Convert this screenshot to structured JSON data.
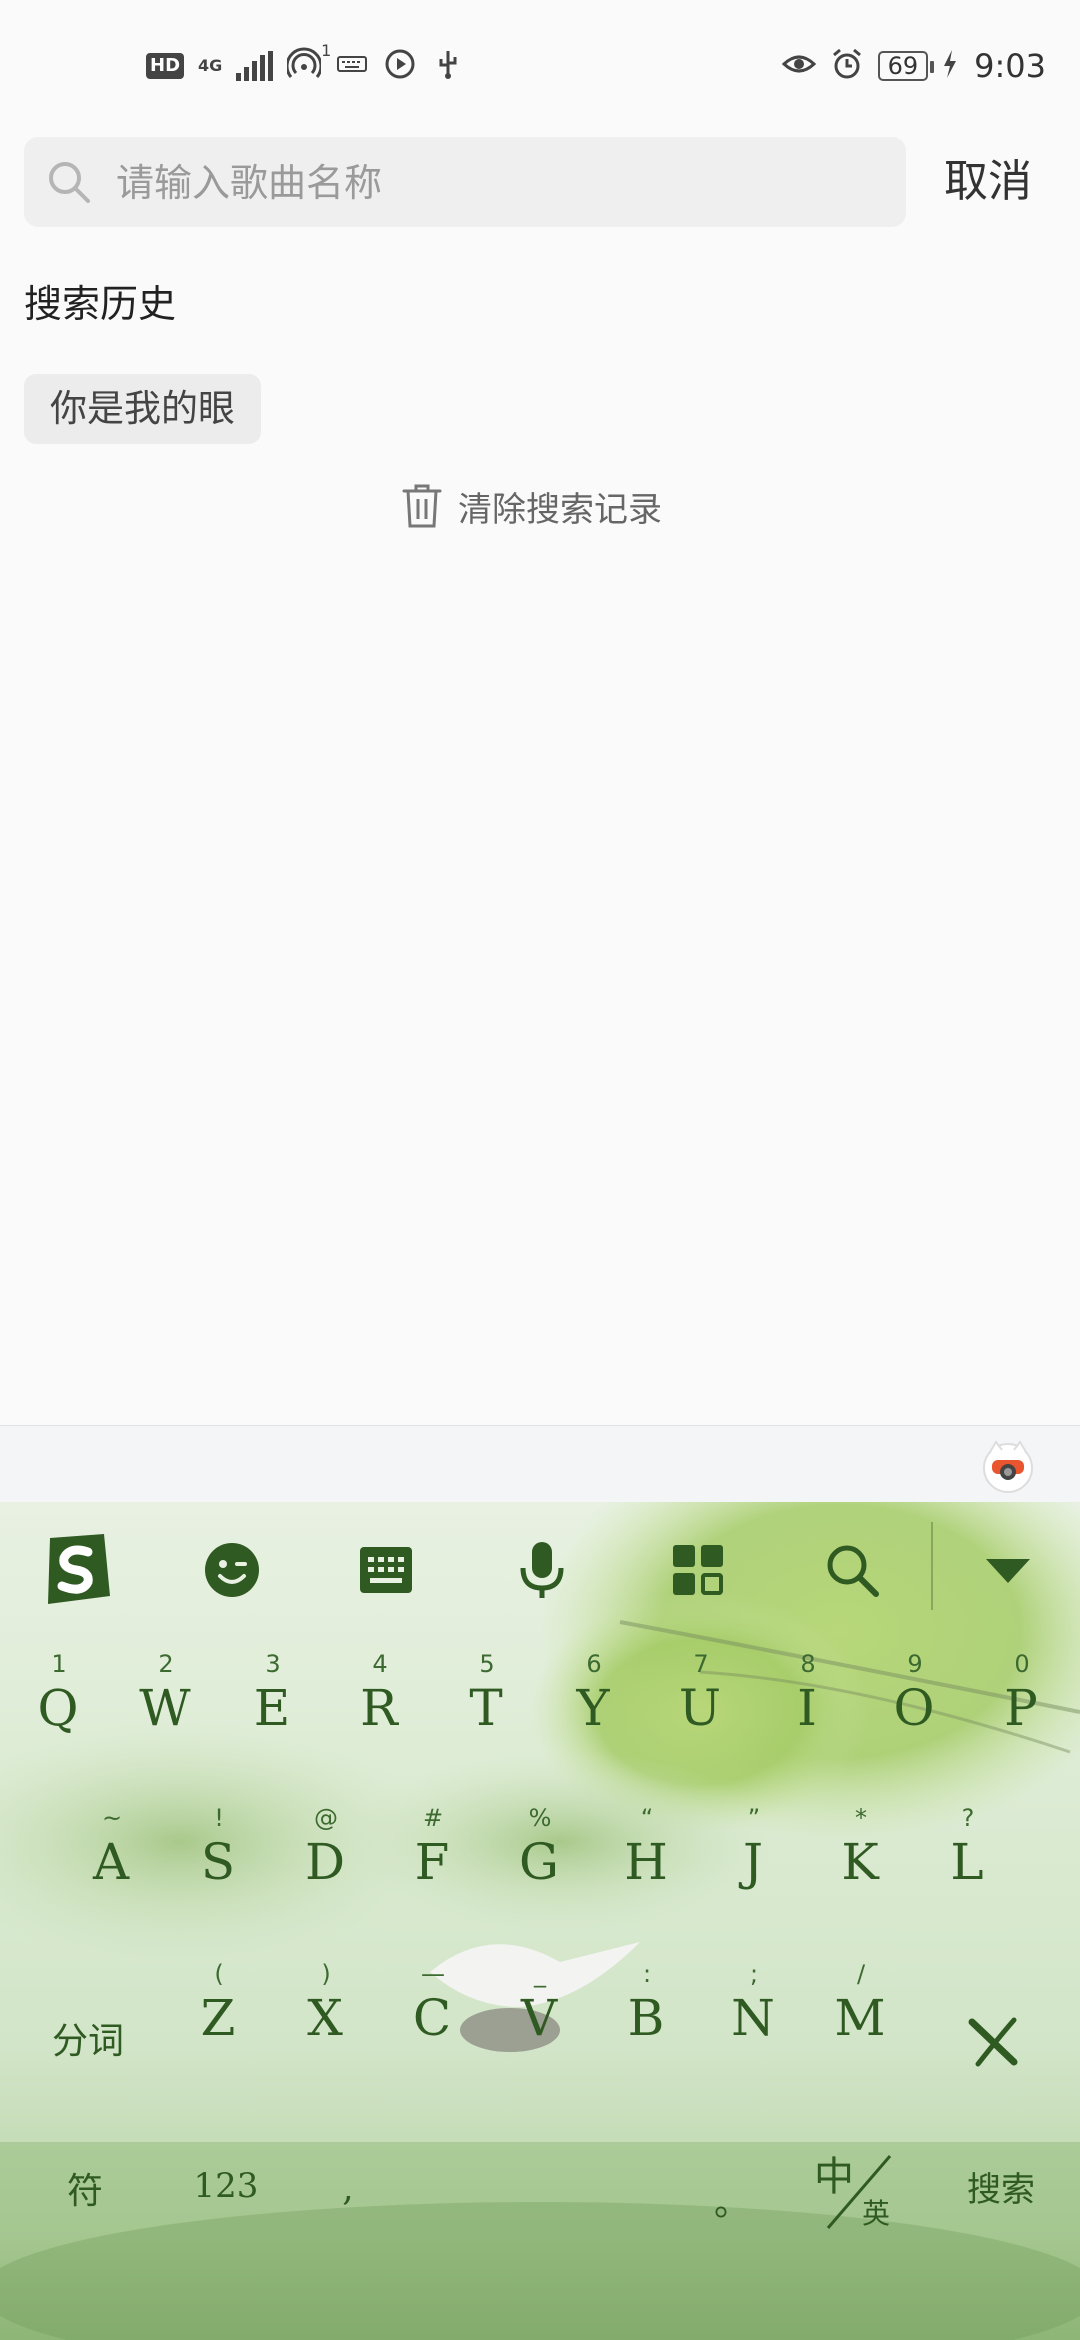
{
  "status_bar": {
    "hd": "HD",
    "network": "4G",
    "hotspot_count": "1",
    "battery": "69",
    "time": "9:03"
  },
  "search": {
    "placeholder": "请输入歌曲名称",
    "value": "",
    "cancel_label": "取消"
  },
  "history": {
    "title": "搜索历史",
    "items": [
      "你是我的眼"
    ],
    "clear_label": "清除搜索记录"
  },
  "keyboard": {
    "accent_color": "#2f5a22",
    "toolbar_icons": [
      "sogou-logo-icon",
      "emoji-icon",
      "keyboard-icon",
      "microphone-icon",
      "apps-grid-icon",
      "search-icon",
      "collapse-icon"
    ],
    "row1": [
      {
        "hint": "1",
        "key": "Q"
      },
      {
        "hint": "2",
        "key": "W"
      },
      {
        "hint": "3",
        "key": "E"
      },
      {
        "hint": "4",
        "key": "R"
      },
      {
        "hint": "5",
        "key": "T"
      },
      {
        "hint": "6",
        "key": "Y"
      },
      {
        "hint": "7",
        "key": "U"
      },
      {
        "hint": "8",
        "key": "I"
      },
      {
        "hint": "9",
        "key": "O"
      },
      {
        "hint": "0",
        "key": "P"
      }
    ],
    "row2": [
      {
        "hint": "~",
        "key": "A"
      },
      {
        "hint": "!",
        "key": "S"
      },
      {
        "hint": "@",
        "key": "D"
      },
      {
        "hint": "#",
        "key": "F"
      },
      {
        "hint": "%",
        "key": "G"
      },
      {
        "hint": "“",
        "key": "H"
      },
      {
        "hint": "”",
        "key": "J"
      },
      {
        "hint": "*",
        "key": "K"
      },
      {
        "hint": "?",
        "key": "L"
      }
    ],
    "row3": [
      {
        "hint": "(",
        "key": "Z"
      },
      {
        "hint": ")",
        "key": "X"
      },
      {
        "hint": "—",
        "key": "C"
      },
      {
        "hint": "_",
        "key": "V"
      },
      {
        "hint": ":",
        "key": "B"
      },
      {
        "hint": ";",
        "key": "N"
      },
      {
        "hint": "/",
        "key": "M"
      }
    ],
    "segment_label": "分词",
    "symbols_label": "符",
    "numbers_label": "123",
    "comma_label": ",",
    "period_label": "。",
    "lang_cn": "中",
    "lang_en": "英",
    "search_label": "搜索"
  }
}
